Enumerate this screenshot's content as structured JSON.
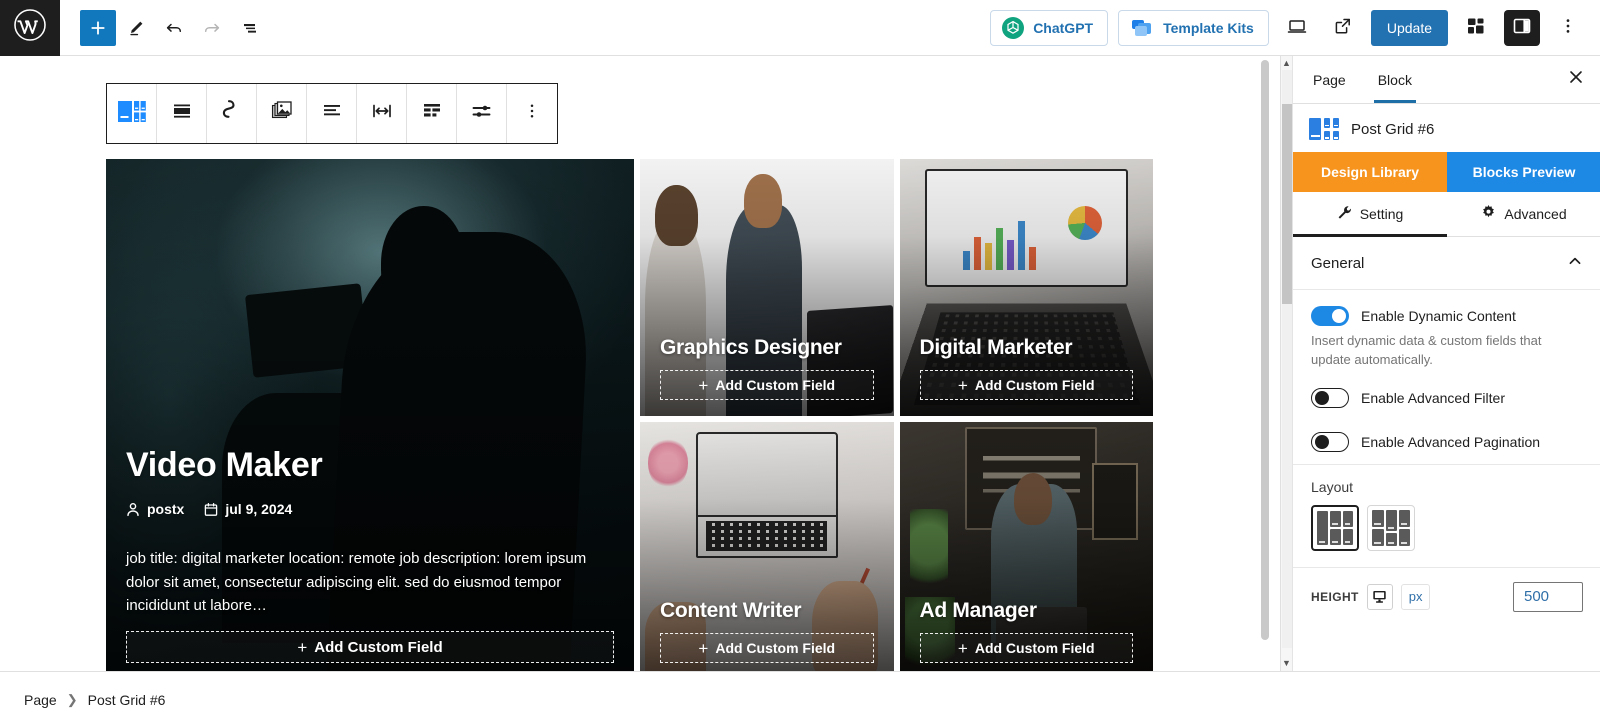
{
  "topbar": {
    "logo_icon": "wordpress-logo",
    "add_block_label": "+",
    "tools": [
      {
        "name": "add-block",
        "icon": "plus-icon"
      },
      {
        "name": "edit-mode",
        "icon": "pencil-icon"
      },
      {
        "name": "undo",
        "icon": "undo-arrow-icon"
      },
      {
        "name": "redo",
        "icon": "redo-arrow-icon"
      },
      {
        "name": "document-overview",
        "icon": "list-view-icon"
      }
    ],
    "chatgpt_label": "ChatGPT",
    "template_kits_label": "Template Kits",
    "preview_icon": "desktop-preview-icon",
    "view_icon": "external-link-icon",
    "update_label": "Update",
    "blocks_icon": "blocks-icon",
    "settings_icon": "settings-sidebar-icon",
    "options_icon": "vertical-ellipsis-icon"
  },
  "block_toolbar": {
    "items": [
      {
        "name": "post-grid-block-icon",
        "icon": "post-grid-icon"
      },
      {
        "name": "drag-handle",
        "icon": "drag-handle-icon"
      },
      {
        "name": "transform-block",
        "icon": "infinity-icon"
      },
      {
        "name": "image-settings",
        "icon": "images-icon"
      },
      {
        "name": "align-text",
        "icon": "align-left-icon"
      },
      {
        "name": "full-width",
        "icon": "arrows-horizontal-icon"
      },
      {
        "name": "grid-columns",
        "icon": "grid-icon"
      },
      {
        "name": "block-settings",
        "icon": "sliders-icon"
      },
      {
        "name": "more-options",
        "icon": "vertical-ellipsis-icon"
      }
    ]
  },
  "posts": [
    {
      "title": "Video Maker",
      "author": "postx",
      "date": "jul 9, 2024",
      "excerpt": "job title: digital marketer location: remote job description: lorem ipsum dolor sit amet, consectetur adipiscing elit. sed do eiusmod tempor incididunt ut labore…",
      "add_field_label": "Add Custom Field",
      "author_icon": "person-icon",
      "date_icon": "calendar-icon"
    },
    {
      "title": "Graphics Designer",
      "add_field_label": "Add Custom Field"
    },
    {
      "title": "Digital Marketer",
      "add_field_label": "Add Custom Field"
    },
    {
      "title": "Content Writer",
      "add_field_label": "Add Custom Field"
    },
    {
      "title": "Ad Manager",
      "add_field_label": "Add Custom Field"
    }
  ],
  "sidebar": {
    "tabs": [
      {
        "label": "Page",
        "active": false
      },
      {
        "label": "Block",
        "active": true
      }
    ],
    "close_icon": "close-icon",
    "block_name": "Post Grid #6",
    "block_icon": "post-grid-icon",
    "design_library_label": "Design Library",
    "blocks_preview_label": "Blocks Preview",
    "setting_tab_label": "Setting",
    "setting_tab_icon": "wrench-icon",
    "advanced_tab_label": "Advanced",
    "advanced_tab_icon": "gear-icon",
    "general_label": "General",
    "general_chevron_icon": "chevron-up-icon",
    "toggles": [
      {
        "label": "Enable Dynamic Content",
        "state": "on"
      },
      {
        "label": "Enable Advanced Filter",
        "state": "off"
      },
      {
        "label": "Enable Advanced Pagination",
        "state": "off"
      }
    ],
    "dynamic_help": "Insert dynamic data & custom fields that update automatically.",
    "layout_label": "Layout",
    "layout_options": [
      {
        "name": "layout-option-1",
        "selected": true
      },
      {
        "name": "layout-option-2",
        "selected": false
      }
    ],
    "height_label": "HEIGHT",
    "height_device_icon": "desktop-icon",
    "height_unit": "px",
    "height_value": "500"
  },
  "footer": {
    "breadcrumb": [
      {
        "label": "Page"
      },
      {
        "label": "Post Grid #6"
      }
    ],
    "separator_icon": "chevron-right-icon"
  },
  "colors": {
    "wp_blue": "#2271b1",
    "toolbar_blue": "#1278bd",
    "accent_orange": "#F7941E",
    "accent_blue": "#1E88E5",
    "link_blue": "#2271b1"
  }
}
